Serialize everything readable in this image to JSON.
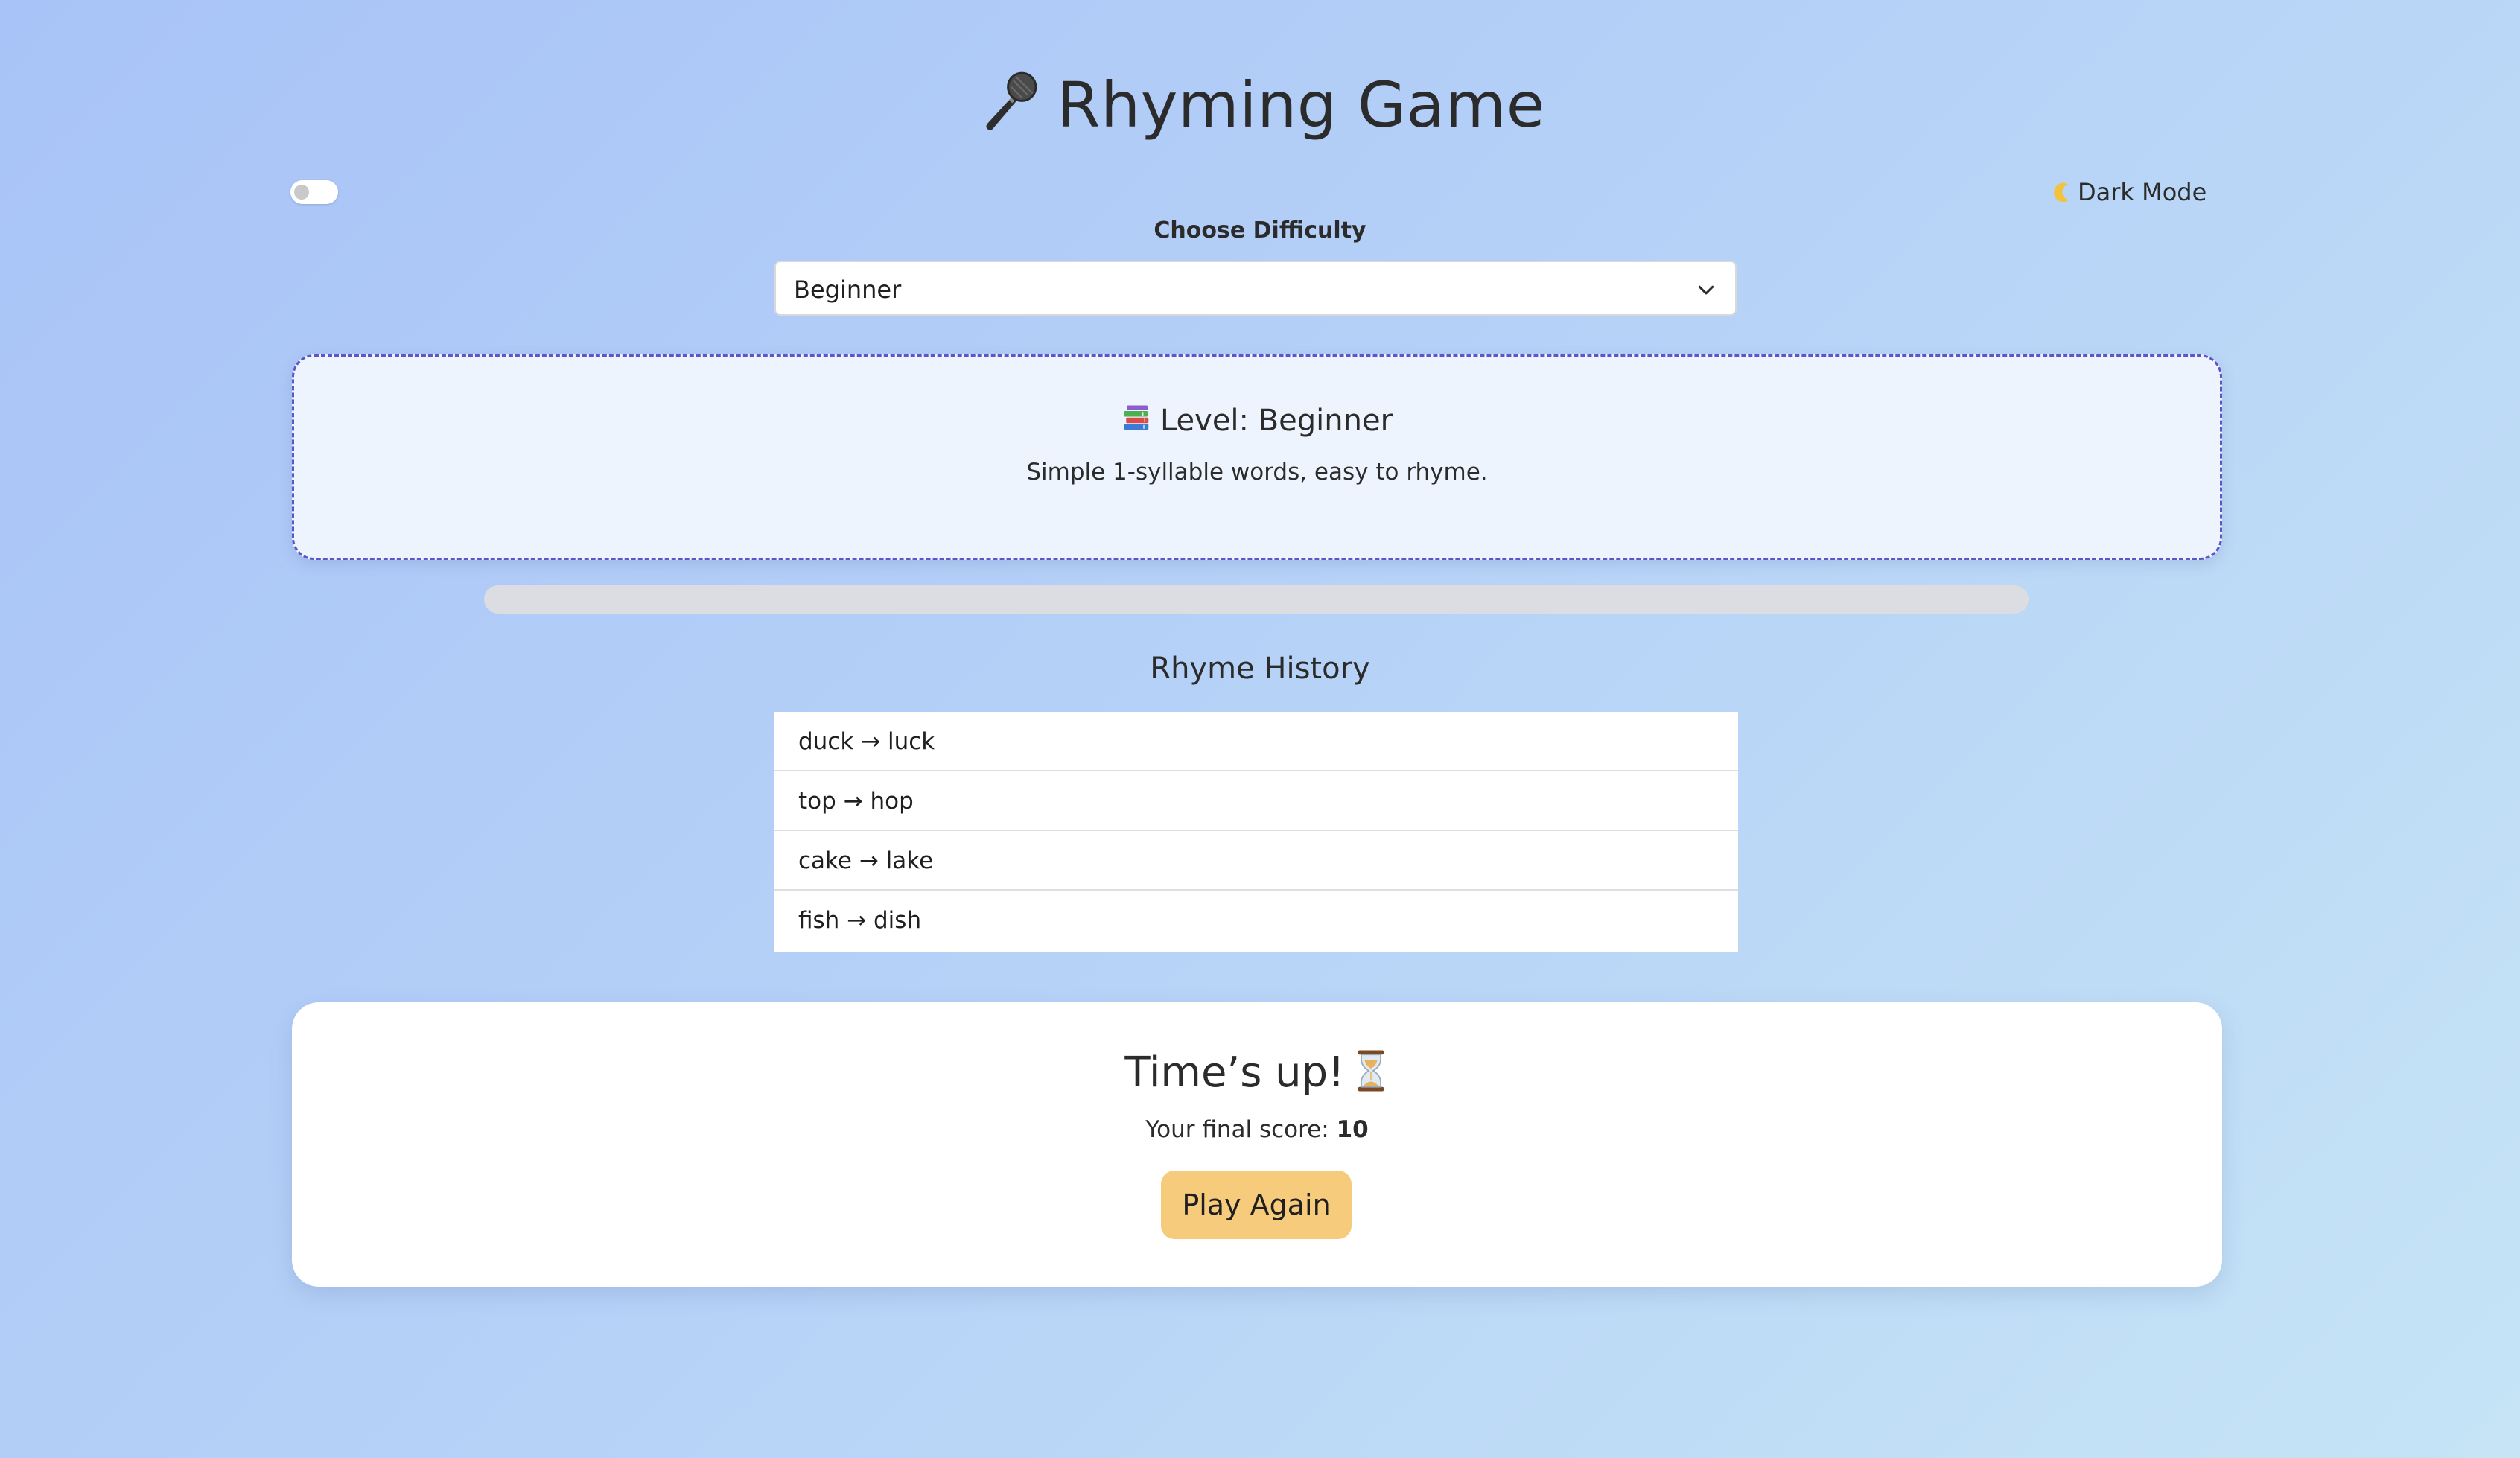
{
  "header": {
    "title": "Rhyming Game",
    "title_icon": "microphone-icon"
  },
  "theme_toggle": {
    "label": "Dark Mode",
    "icon": "moon-icon",
    "enabled": false
  },
  "difficulty": {
    "label": "Choose Difficulty",
    "selected": "Beginner"
  },
  "level_card": {
    "icon": "books-icon",
    "title": "Level: Beginner",
    "description": "Simple 1-syllable words, easy to rhyme."
  },
  "progress": {
    "fraction": 0
  },
  "history": {
    "heading": "Rhyme History",
    "items": [
      "duck → luck",
      "top → hop",
      "cake → lake",
      "fish → dish"
    ]
  },
  "result": {
    "title": "Time’s up!",
    "icon": "hourglass-icon",
    "score_label": "Your final score:",
    "score_value": "10",
    "play_again_label": "Play Again"
  },
  "colors": {
    "accent": "#5b57c9",
    "button": "#f6cb7c",
    "background_start": "#a8c3f7",
    "background_end": "#c6e4f6"
  }
}
